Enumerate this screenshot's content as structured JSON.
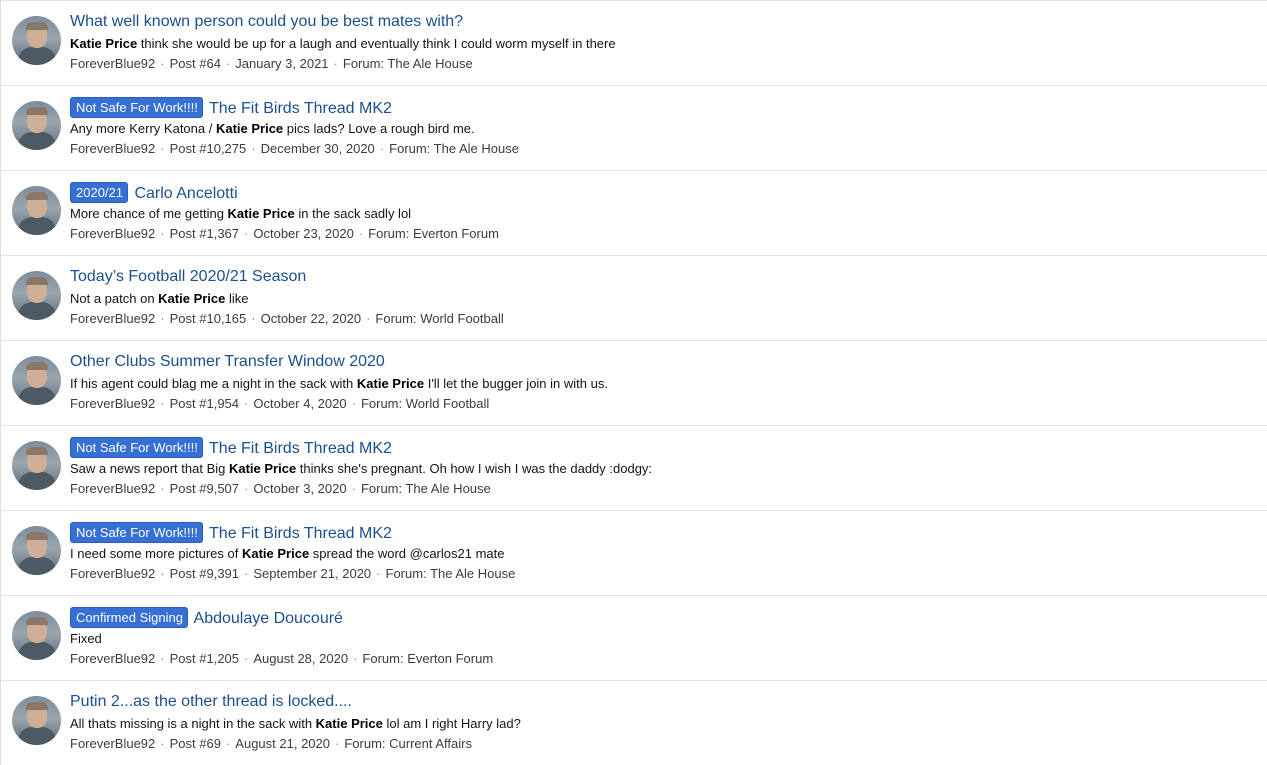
{
  "results": [
    {
      "label": "",
      "title": "What well known person could you be best mates with?",
      "snippet": [
        "",
        "Katie Price",
        " think she would be up for a laugh and eventually think I could worm myself in there"
      ],
      "author": "ForeverBlue92",
      "post": "Post #64",
      "date": "January 3, 2021",
      "forum": "Forum: The Ale House"
    },
    {
      "label": "Not Safe For Work!!!!",
      "title": "The Fit Birds Thread MK2",
      "snippet": [
        "Any more Kerry Katona / ",
        "Katie Price",
        " pics lads? Love a rough bird me."
      ],
      "author": "ForeverBlue92",
      "post": "Post #10,275",
      "date": "December 30, 2020",
      "forum": "Forum: The Ale House"
    },
    {
      "label": "2020/21",
      "title": "Carlo Ancelotti",
      "snippet": [
        "More chance of me getting ",
        "Katie Price",
        " in the sack sadly lol"
      ],
      "author": "ForeverBlue92",
      "post": "Post #1,367",
      "date": "October 23, 2020",
      "forum": "Forum: Everton Forum"
    },
    {
      "label": "",
      "title": "Today’s Football 2020/21 Season",
      "snippet": [
        "Not a patch on ",
        "Katie Price",
        " like"
      ],
      "author": "ForeverBlue92",
      "post": "Post #10,165",
      "date": "October 22, 2020",
      "forum": "Forum: World Football"
    },
    {
      "label": "",
      "title": "Other Clubs Summer Transfer Window 2020",
      "snippet": [
        "If his agent could blag me a night in the sack with ",
        "Katie Price",
        " I'll let the bugger join in with us."
      ],
      "author": "ForeverBlue92",
      "post": "Post #1,954",
      "date": "October 4, 2020",
      "forum": "Forum: World Football"
    },
    {
      "label": "Not Safe For Work!!!!",
      "title": "The Fit Birds Thread MK2",
      "snippet": [
        "Saw a news report that Big ",
        "Katie Price",
        " thinks she's pregnant. Oh how I wish I was the daddy :dodgy:"
      ],
      "author": "ForeverBlue92",
      "post": "Post #9,507",
      "date": "October 3, 2020",
      "forum": "Forum: The Ale House"
    },
    {
      "label": "Not Safe For Work!!!!",
      "title": "The Fit Birds Thread MK2",
      "snippet": [
        "I need some more pictures of ",
        "Katie Price",
        " spread the word @carlos21 mate"
      ],
      "author": "ForeverBlue92",
      "post": "Post #9,391",
      "date": "September 21, 2020",
      "forum": "Forum: The Ale House"
    },
    {
      "label": "Confirmed Signing",
      "title": "Abdoulaye Doucouré",
      "snippet": [
        "Fixed",
        "",
        ""
      ],
      "author": "ForeverBlue92",
      "post": "Post #1,205",
      "date": "August 28, 2020",
      "forum": "Forum: Everton Forum"
    },
    {
      "label": "",
      "title": "Putin 2...as the other thread is locked....",
      "snippet": [
        "All thats missing is a night in the sack with ",
        "Katie Price",
        " lol am I right Harry lad?"
      ],
      "author": "ForeverBlue92",
      "post": "Post #69",
      "date": "August 21, 2020",
      "forum": "Forum: Current Affairs"
    }
  ]
}
